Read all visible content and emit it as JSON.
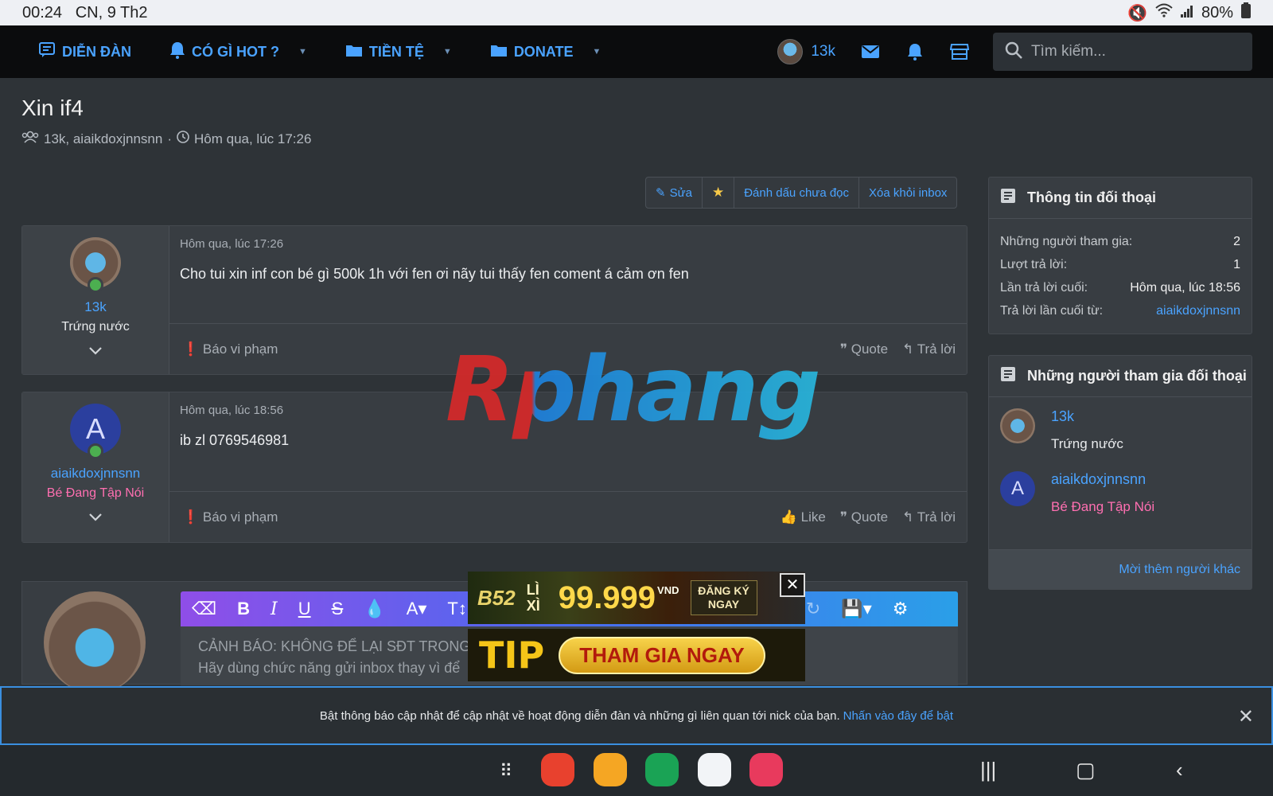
{
  "status": {
    "time": "00:24",
    "date": "CN, 9 Th2",
    "battery": "80%"
  },
  "nav": {
    "items": [
      {
        "label": "DIỄN ĐÀN",
        "icon": "forum-icon",
        "caret": false
      },
      {
        "label": "CÓ GÌ HOT ?",
        "icon": "bell-icon",
        "caret": true
      },
      {
        "label": "TIỀN TỆ",
        "icon": "folder-icon",
        "caret": true
      },
      {
        "label": "DONATE",
        "icon": "folder-icon",
        "caret": true
      }
    ],
    "username": "13k",
    "search_placeholder": "Tìm kiếm..."
  },
  "conversation": {
    "title": "Xin if4",
    "participants": "13k, aiaikdoxjnnsnn",
    "time": "Hôm qua, lúc 17:26",
    "actions": {
      "edit": "Sửa",
      "mark_unread": "Đánh dấu chưa đọc",
      "remove": "Xóa khỏi inbox"
    }
  },
  "messages": [
    {
      "username": "13k",
      "user_title": "Trứng nước",
      "user_title_color": "#e8eaec",
      "time": "Hôm qua, lúc 17:26",
      "body": "Cho tui xin inf con bé gì 500k 1h với fen ơi nãy tui thấy fen coment á cảm ơn fen",
      "report": "Báo vi phạm",
      "actions": [
        "Quote",
        "Trả lời"
      ]
    },
    {
      "username": "aiaikdoxjnnsnn",
      "avatar_letter": "A",
      "user_title": "Bé Đang Tập Nói",
      "user_title_color": "#ff6fb1",
      "time": "Hôm qua, lúc 18:56",
      "body": "ib zl 0769546981",
      "report": "Báo vi phạm",
      "actions": [
        "Like",
        "Quote",
        "Trả lời"
      ]
    }
  ],
  "editor": {
    "warning_line1": "CẢNH BÁO: KHÔNG ĐỂ LẠI SĐT TRONG B",
    "warning_line2": "Hãy dùng chức năng gửi inbox thay vì để"
  },
  "watermark": "Rphang",
  "ads": {
    "ad1": {
      "brand": "B52",
      "lixi": "LÌ XÌ",
      "amount": "99.999",
      "currency": "VND",
      "cta": "ĐĂNG KÝ NGAY"
    },
    "ad2": {
      "brand": "TIP",
      "cta": "THAM GIA NGAY"
    }
  },
  "sidebar": {
    "info": {
      "heading": "Thông tin đối thoại",
      "rows": [
        {
          "k": "Những người tham gia:",
          "v": "2"
        },
        {
          "k": "Lượt trả lời:",
          "v": "1"
        },
        {
          "k": "Lần trả lời cuối:",
          "v": "Hôm qua, lúc 18:56"
        },
        {
          "k": "Trả lời lần cuối từ:",
          "v": "aiaikdoxjnnsnn"
        }
      ]
    },
    "participants": {
      "heading": "Những người tham gia đối thoại",
      "list": [
        {
          "name": "13k",
          "title": "Trứng nước"
        },
        {
          "name": "aiaikdoxjnnsnn",
          "title": "Bé Đang Tập Nói",
          "letter": "A"
        }
      ],
      "invite": "Mời thêm người khác"
    }
  },
  "notification": {
    "text": "Bật thông báo cập nhật để cập nhật về hoạt động diễn đàn và những gì liên quan tới nick của bạn.",
    "link": "Nhấn vào đây để bật"
  },
  "colors": {
    "accent": "#4aa3ff",
    "nav_bg": "#0b0c0d",
    "page_bg": "#2e3337",
    "online": "#4caf50"
  }
}
